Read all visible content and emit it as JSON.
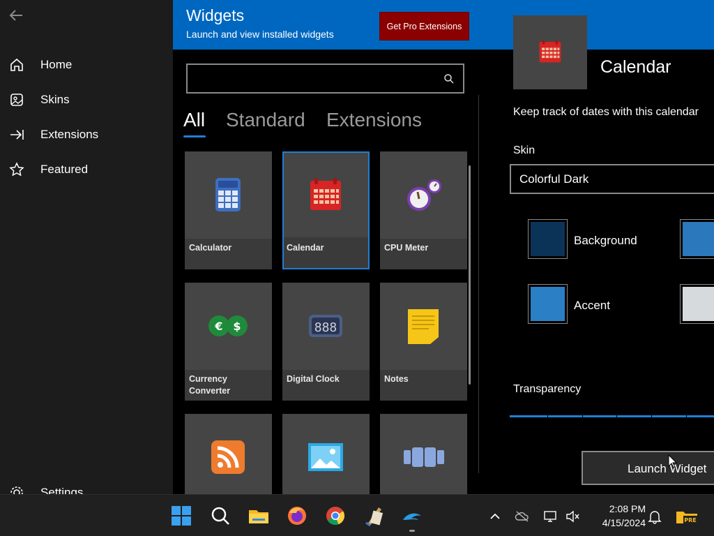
{
  "sidebar": {
    "back_label": "←",
    "items": [
      {
        "label": "Home",
        "icon": "home-icon"
      },
      {
        "label": "Skins",
        "icon": "skins-icon"
      },
      {
        "label": "Extensions",
        "icon": "extensions-icon"
      },
      {
        "label": "Featured",
        "icon": "star-icon"
      }
    ],
    "settings_label": "Settings"
  },
  "header": {
    "title": "Widgets",
    "subtitle": "Launch and view installed widgets",
    "pro_button": "Get Pro Extensions",
    "color": "#0067c0"
  },
  "search": {
    "value": "",
    "placeholder": ""
  },
  "tabs": [
    {
      "label": "All",
      "active": true
    },
    {
      "label": "Standard",
      "active": false
    },
    {
      "label": "Extensions",
      "active": false
    }
  ],
  "widgets": [
    {
      "label": "Calculator",
      "icon": "calculator-icon"
    },
    {
      "label": "Calendar",
      "icon": "calendar-icon",
      "selected": true
    },
    {
      "label": "CPU Meter",
      "icon": "cpu-meter-icon"
    },
    {
      "label": "Currency Converter",
      "icon": "currency-icon"
    },
    {
      "label": "Digital Clock",
      "icon": "digital-clock-icon"
    },
    {
      "label": "Notes",
      "icon": "notes-icon"
    },
    {
      "label": "",
      "icon": "rss-icon"
    },
    {
      "label": "",
      "icon": "picture-icon"
    },
    {
      "label": "",
      "icon": "slideshow-icon"
    }
  ],
  "detail": {
    "title": "Calendar",
    "description": "Keep track of dates with this calendar",
    "skin_label": "Skin",
    "skin_value": "Colorful Dark",
    "swatches": [
      {
        "label": "Background",
        "color": "#0b3358"
      },
      {
        "label": "",
        "color": "#2b78bd"
      },
      {
        "label": "Accent",
        "color": "#2b7fc4"
      },
      {
        "label": "",
        "color": "#d7dadd"
      }
    ],
    "transparency_label": "Transparency",
    "transparency_value": 1.0,
    "launch_button": "Launch Widget",
    "accent": "#1f7fd6"
  },
  "taskbar": {
    "apps": [
      "start-icon",
      "search-icon",
      "file-explorer-icon",
      "firefox-icon",
      "chrome-icon",
      "file-tool-icon",
      "dolphin-icon"
    ],
    "tray": [
      "chevron-up-icon",
      "cloud-off-icon",
      "network-icon",
      "volume-muted-icon"
    ],
    "time": "2:08 PM",
    "date": "4/15/2024"
  }
}
